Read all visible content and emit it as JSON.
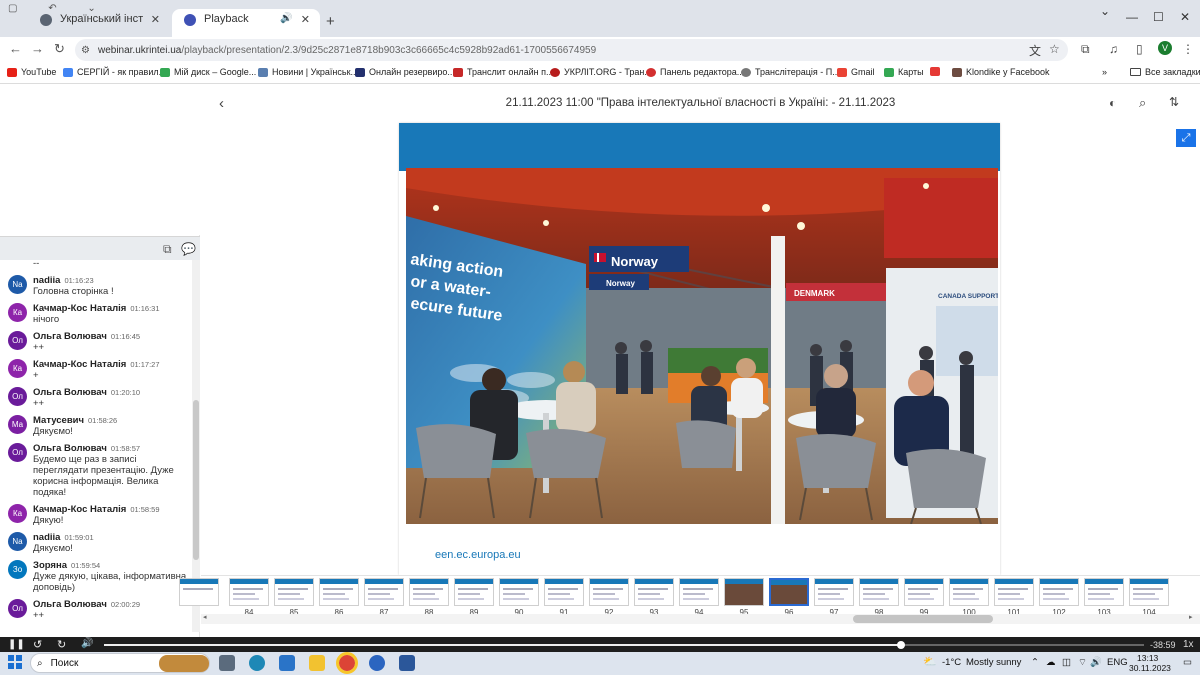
{
  "browser": {
    "tabs": [
      {
        "title": "Український інститут науково",
        "active": false,
        "favicon_color": "#5a6472"
      },
      {
        "title": "Playback",
        "active": true,
        "favicon_color": "#3f51b5"
      }
    ],
    "url_site": "webinar.ukrintei.ua",
    "url_path": "/playback/presentation/2.3/9d25c2871e8718b903c3c66665c4c5928b92ad61-1700556674959",
    "profile_initial": "V",
    "bookmarks": [
      {
        "label": "YouTube",
        "color": "#e62117"
      },
      {
        "label": "СЕРГІЙ - як правил...",
        "color": "#4285f4"
      },
      {
        "label": "Мій диск – Google...",
        "color": "#34a853"
      },
      {
        "label": "Новини | Українськ...",
        "color": "#5a7fb0"
      },
      {
        "label": "Онлайн резервиро...",
        "color": "#23306e"
      },
      {
        "label": "Транслит онлайн п...",
        "color": "#c62828"
      },
      {
        "label": "УКРЛІТ.ORG - Тран...",
        "color": "#b71c1c"
      },
      {
        "label": "Панель редактора...",
        "color": "#d32f2f"
      },
      {
        "label": "Транслітерація - П...",
        "color": "#777777"
      },
      {
        "label": "Gmail",
        "color": "#ea4335"
      },
      {
        "label": "Карты",
        "color": "#34a853"
      },
      {
        "label": "",
        "color": "#e53935"
      },
      {
        "label": "Klondike у Facebook",
        "color": "#6d4c41"
      }
    ],
    "all_bookmarks_label": "Все закладки"
  },
  "chat": {
    "first_text": "--",
    "messages": [
      {
        "initials": "Na",
        "name": "nadiia",
        "time": "01:16:23",
        "text": "Головна сторінка !",
        "color": "#1e5aa8"
      },
      {
        "initials": "Ка",
        "name": "Качмар-Кос Наталія",
        "time": "01:16:31",
        "text": "нічого",
        "color": "#8e24aa"
      },
      {
        "initials": "Ол",
        "name": "Ольга Волювач",
        "time": "01:16:45",
        "text": "++",
        "color": "#6a1b9a"
      },
      {
        "initials": "Ка",
        "name": "Качмар-Кос Наталія",
        "time": "01:17:27",
        "text": "+",
        "color": "#8e24aa"
      },
      {
        "initials": "Ол",
        "name": "Ольга Волювач",
        "time": "01:20:10",
        "text": "++",
        "color": "#6a1b9a"
      },
      {
        "initials": "Ма",
        "name": "Матусевич",
        "time": "01:58:26",
        "text": "Дякуємо!",
        "color": "#7b1fa2"
      },
      {
        "initials": "Ол",
        "name": "Ольга Волювач",
        "time": "01:58:57",
        "text": "Будемо ще раз в записі переглядати презентацію. Дуже корисна інформація. Велика подяка!",
        "color": "#6a1b9a"
      },
      {
        "initials": "Ка",
        "name": "Качмар-Кос Наталія",
        "time": "01:58:59",
        "text": "Дякую!",
        "color": "#8e24aa"
      },
      {
        "initials": "Na",
        "name": "nadiia",
        "time": "01:59:01",
        "text": "Дякуємо!",
        "color": "#1e5aa8"
      },
      {
        "initials": "Зо",
        "name": "Зоряна",
        "time": "01:59:54",
        "text": "Дуже дякую, цікава, інформативна доповідь)",
        "color": "#0277bd"
      },
      {
        "initials": "Ол",
        "name": "Ольга Волювач",
        "time": "02:00:29",
        "text": "++",
        "color": "#6a1b9a"
      }
    ]
  },
  "presentation": {
    "title": "21.11.2023 11:00 \"Права інтелектуальної власності в Україні: - 21.11.2023",
    "slide_link": "een.ec.europa.eu",
    "accent_color": "#1878b8",
    "photo_texts": {
      "banner": "aking action\nor a water-\necure future",
      "norway1": "Norway",
      "norway2": "Norway",
      "denmark": "DENMARK",
      "canada": "CANADA SUPPORT"
    },
    "thumb_numbers": [
      "84",
      "85",
      "86",
      "87",
      "88",
      "89",
      "90",
      "91",
      "92",
      "93",
      "94",
      "95",
      "96",
      "97",
      "98",
      "99",
      "100",
      "101",
      "102",
      "103",
      "104"
    ],
    "selected_thumb": "96"
  },
  "player": {
    "remaining": "-38:59",
    "speed": "1x",
    "progress_fraction": 0.766
  },
  "taskbar": {
    "search_label": "Поиск",
    "temperature": "-1°C",
    "weather": "Mostly sunny",
    "language": "ENG",
    "time": "13:13",
    "date": "30.11.2023"
  }
}
